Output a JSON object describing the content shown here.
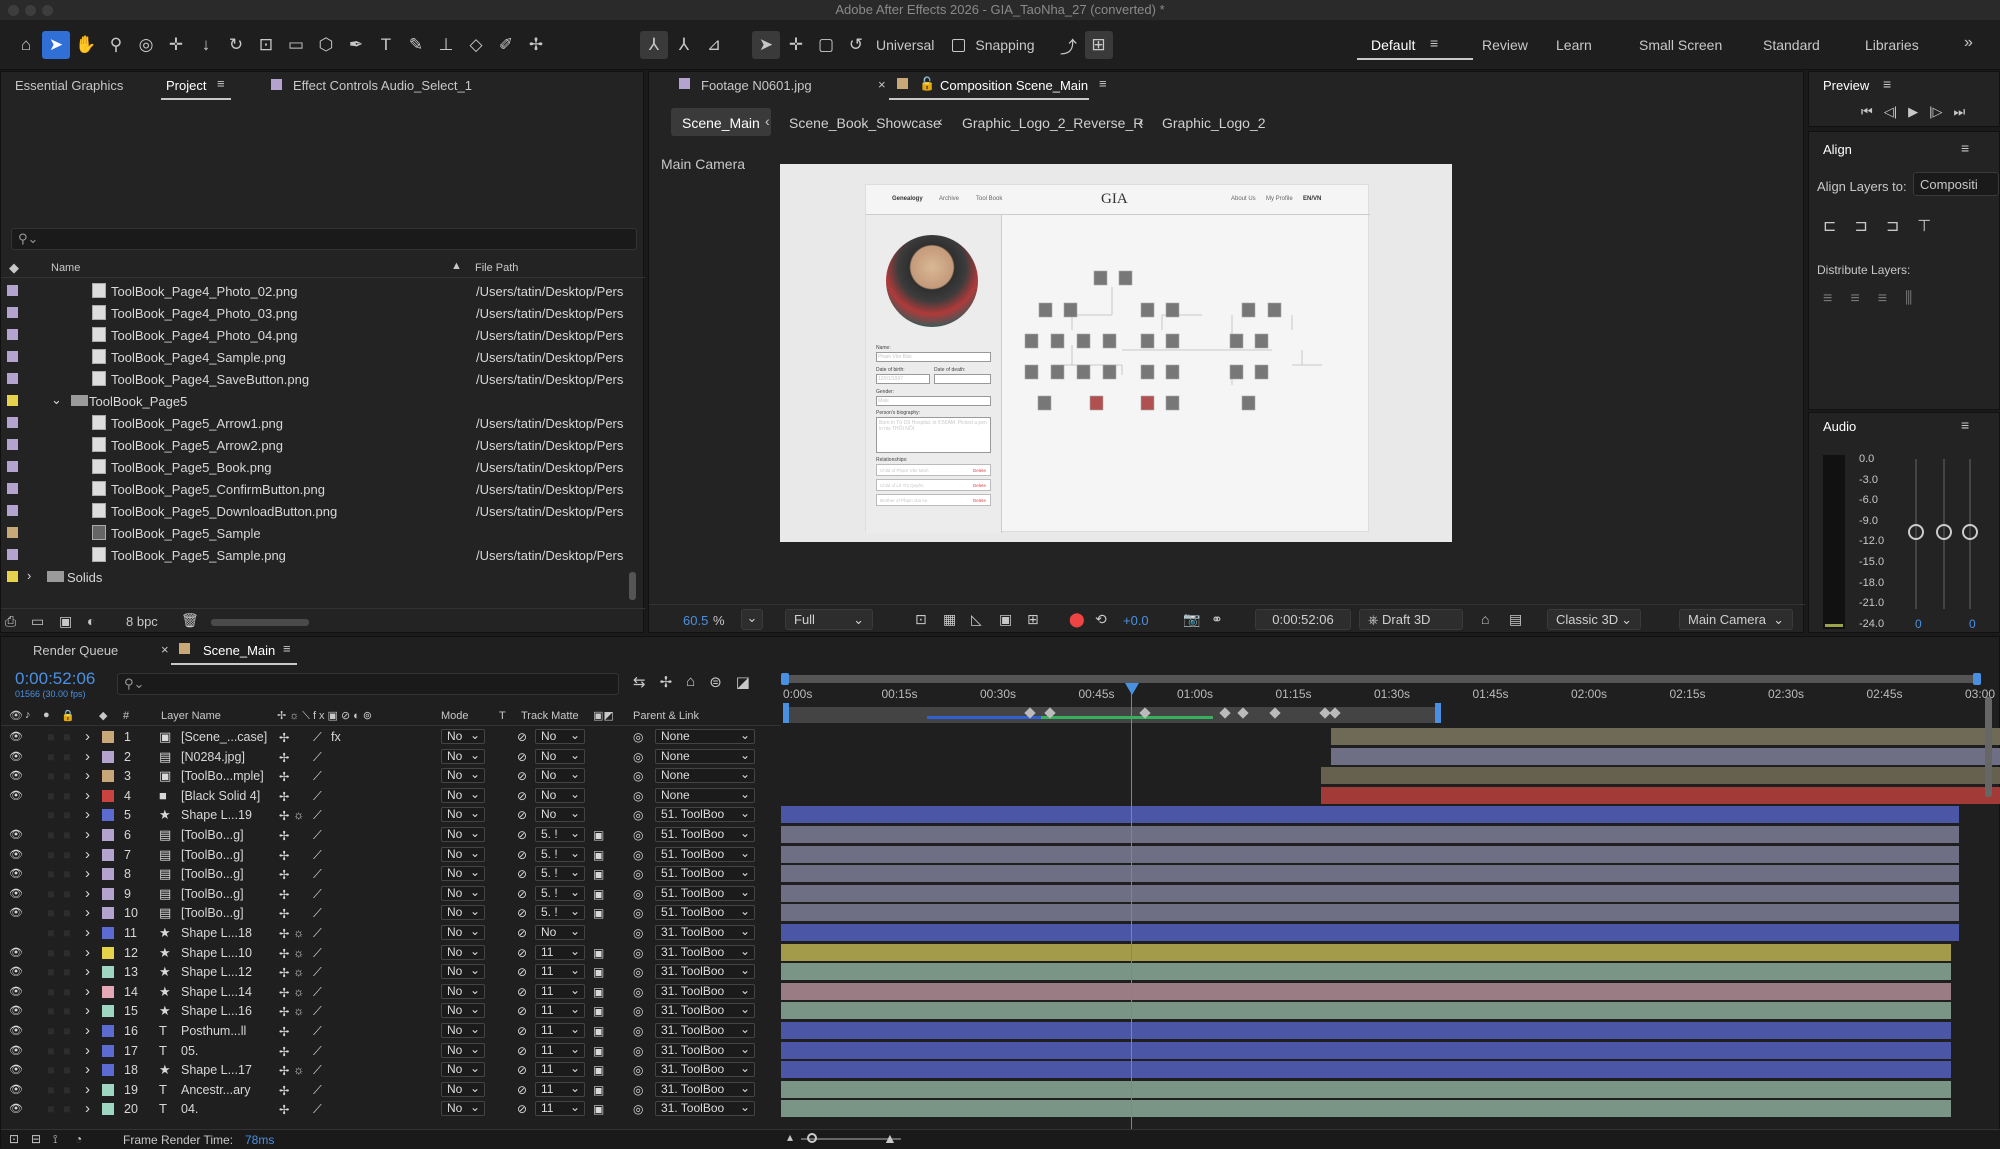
{
  "window_title": "Adobe After Effects 2026 - GIA_TaoNha_27 (converted) *",
  "toolbar": {
    "universal": "Universal",
    "snapping": "Snapping"
  },
  "workspaces": [
    "Default",
    "Review",
    "Learn",
    "Small Screen",
    "Standard",
    "Libraries"
  ],
  "left_tabs": {
    "essential": "Essential Graphics",
    "project": "Project",
    "effect": "Effect Controls Audio_Select_1"
  },
  "project": {
    "col_name": "Name",
    "col_path": "File Path",
    "bpc": "8 bpc",
    "rows": [
      {
        "name": "ToolBook_Page4_Photo_02.png",
        "path": "/Users/tatin/Desktop/Pers",
        "color": "#b4a2cf",
        "type": "file"
      },
      {
        "name": "ToolBook_Page4_Photo_03.png",
        "path": "/Users/tatin/Desktop/Pers",
        "color": "#b4a2cf",
        "type": "file"
      },
      {
        "name": "ToolBook_Page4_Photo_04.png",
        "path": "/Users/tatin/Desktop/Pers",
        "color": "#b4a2cf",
        "type": "file"
      },
      {
        "name": "ToolBook_Page4_Sample.png",
        "path": "/Users/tatin/Desktop/Pers",
        "color": "#b4a2cf",
        "type": "file"
      },
      {
        "name": "ToolBook_Page4_SaveButton.png",
        "path": "/Users/tatin/Desktop/Pers",
        "color": "#b4a2cf",
        "type": "file"
      },
      {
        "name": "ToolBook_Page5",
        "path": "",
        "color": "#e6d24b",
        "type": "folder"
      },
      {
        "name": "ToolBook_Page5_Arrow1.png",
        "path": "/Users/tatin/Desktop/Pers",
        "color": "#b4a2cf",
        "type": "file"
      },
      {
        "name": "ToolBook_Page5_Arrow2.png",
        "path": "/Users/tatin/Desktop/Pers",
        "color": "#b4a2cf",
        "type": "file"
      },
      {
        "name": "ToolBook_Page5_Book.png",
        "path": "/Users/tatin/Desktop/Pers",
        "color": "#b4a2cf",
        "type": "file"
      },
      {
        "name": "ToolBook_Page5_ConfirmButton.png",
        "path": "/Users/tatin/Desktop/Pers",
        "color": "#b4a2cf",
        "type": "file"
      },
      {
        "name": "ToolBook_Page5_DownloadButton.png",
        "path": "/Users/tatin/Desktop/Pers",
        "color": "#b4a2cf",
        "type": "file"
      },
      {
        "name": "ToolBook_Page5_Sample",
        "path": "",
        "color": "#c8a878",
        "type": "comp"
      },
      {
        "name": "ToolBook_Page5_Sample.png",
        "path": "/Users/tatin/Desktop/Pers",
        "color": "#b4a2cf",
        "type": "file"
      },
      {
        "name": "Solids",
        "path": "",
        "color": "#e6d24b",
        "type": "folder"
      }
    ]
  },
  "viewer": {
    "tab_footage": "Footage N0601.jpg",
    "tab_comp": "Composition Scene_Main",
    "crumbs": [
      "Scene_Main",
      "Scene_Book_Showcase",
      "Graphic_Logo_2_Reverse_R",
      "Graphic_Logo_2"
    ],
    "camera_label": "Main Camera",
    "zoom": "60.5",
    "zoom_unit": "%",
    "resolution": "Full",
    "exposure": "+0.0",
    "timecode": "0:00:52:06",
    "draft": "Draft 3D",
    "renderer": "Classic 3D",
    "camera": "Main Camera",
    "mock": {
      "nav": [
        "Genealogy",
        "Archive",
        "Tool Book"
      ],
      "logo": "GIA",
      "nav_right": [
        "About Us",
        "My Profile",
        "EN/VN"
      ],
      "name_label": "Name:",
      "name_value": "Phạm Văn Bảo",
      "dob_label": "Date of birth:",
      "dob_value": "12/01/1997",
      "dod_label": "Date of death:",
      "gender_label": "Gender:",
      "gender_value": "Male",
      "bio_label": "Person's biography:",
      "bio_value": "Born in Từ Dũ Hospital, in 6:55AM. Picked a pen in his THÔI NÔI.",
      "rel_label": "Relationships:",
      "relations": [
        "Child of Phạm Văn Minh",
        "Child of Lê Thị Quyên",
        "Brother of Phạm Gia An"
      ],
      "delete": "Delete"
    }
  },
  "preview": {
    "title": "Preview"
  },
  "align": {
    "title": "Align",
    "align_to_label": "Align Layers to:",
    "align_to_value": "Compositi",
    "distribute": "Distribute Layers:"
  },
  "audio": {
    "title": "Audio",
    "levels": [
      "0.0",
      "-3.0",
      "-6.0",
      "-9.0",
      "-12.0",
      "-15.0",
      "-18.0",
      "-21.0",
      "-24.0"
    ],
    "left_val": "0",
    "right_val": "0"
  },
  "timeline": {
    "tab_render": "Render Queue",
    "tab_comp": "Scene_Main",
    "timecode": "0:00:52:06",
    "frames": "01566 (30.00 fps)",
    "col_layer": "Layer Name",
    "col_mode": "Mode",
    "col_t": "T",
    "col_matte": "Track Matte",
    "col_parent": "Parent & Link",
    "ticks": [
      "0:00s",
      "00:15s",
      "00:30s",
      "00:45s",
      "01:00s",
      "01:15s",
      "01:30s",
      "01:45s",
      "02:00s",
      "02:15s",
      "02:30s",
      "02:45s",
      "03:00"
    ],
    "frame_render_label": "Frame Render Time:",
    "frame_render_value": "78ms",
    "layers": [
      {
        "n": "1",
        "name": "[Scene_...case]",
        "label": "#c8a878",
        "kind": "comp",
        "mode": "No",
        "matte": "No",
        "parent": "None",
        "bar": "#6e6a56"
      },
      {
        "n": "2",
        "name": "[N0284.jpg]",
        "label": "#b4a2cf",
        "kind": "file",
        "mode": "No",
        "matte": "No",
        "parent": "None",
        "bar": "#6e6f85"
      },
      {
        "n": "3",
        "name": "[ToolBo...mple]",
        "label": "#c8a878",
        "kind": "comp",
        "mode": "No",
        "matte": "No",
        "parent": "None",
        "bar": "#66604f"
      },
      {
        "n": "4",
        "name": "[Black Solid 4]",
        "label": "#c9443f",
        "kind": "solid",
        "mode": "No",
        "matte": "No",
        "parent": "None",
        "bar": "#a23a38"
      },
      {
        "n": "5",
        "name": "Shape L...19",
        "label": "#5c6bd1",
        "kind": "shape",
        "mode": "No",
        "matte": "No",
        "parent": "51. ToolBoo",
        "bar": "#4b57a6"
      },
      {
        "n": "6",
        "name": "[ToolBo...g]",
        "label": "#b4a2cf",
        "kind": "file",
        "mode": "No",
        "matte": "5. !",
        "parent": "51. ToolBoo",
        "bar": "#6e6f85"
      },
      {
        "n": "7",
        "name": "[ToolBo...g]",
        "label": "#b4a2cf",
        "kind": "file",
        "mode": "No",
        "matte": "5. !",
        "parent": "51. ToolBoo",
        "bar": "#6e6f85"
      },
      {
        "n": "8",
        "name": "[ToolBo...g]",
        "label": "#b4a2cf",
        "kind": "file",
        "mode": "No",
        "matte": "5. !",
        "parent": "51. ToolBoo",
        "bar": "#6e6f85"
      },
      {
        "n": "9",
        "name": "[ToolBo...g]",
        "label": "#b4a2cf",
        "kind": "file",
        "mode": "No",
        "matte": "5. !",
        "parent": "51. ToolBoo",
        "bar": "#6e6f85"
      },
      {
        "n": "10",
        "name": "[ToolBo...g]",
        "label": "#b4a2cf",
        "kind": "file",
        "mode": "No",
        "matte": "5. !",
        "parent": "51. ToolBoo",
        "bar": "#6e6f85"
      },
      {
        "n": "11",
        "name": "Shape L...18",
        "label": "#5c6bd1",
        "kind": "shape",
        "mode": "No",
        "matte": "No",
        "parent": "31. ToolBoo",
        "bar": "#4b57a6"
      },
      {
        "n": "12",
        "name": "Shape L...10",
        "label": "#e6d24b",
        "kind": "shape",
        "mode": "No",
        "matte": "11",
        "parent": "31. ToolBoo",
        "bar": "#a49b4a"
      },
      {
        "n": "13",
        "name": "Shape L...12",
        "label": "#9fd6c1",
        "kind": "shape",
        "mode": "No",
        "matte": "11",
        "parent": "31. ToolBoo",
        "bar": "#7a9486"
      },
      {
        "n": "14",
        "name": "Shape L...14",
        "label": "#e5a8b7",
        "kind": "shape",
        "mode": "No",
        "matte": "11",
        "parent": "31. ToolBoo",
        "bar": "#9a7c84"
      },
      {
        "n": "15",
        "name": "Shape L...16",
        "label": "#9fd6c1",
        "kind": "shape",
        "mode": "No",
        "matte": "11",
        "parent": "31. ToolBoo",
        "bar": "#7a9486"
      },
      {
        "n": "16",
        "name": "Posthum...ll",
        "label": "#5c6bd1",
        "kind": "text",
        "mode": "No",
        "matte": "11",
        "parent": "31. ToolBoo",
        "bar": "#4b57a6"
      },
      {
        "n": "17",
        "name": "05.",
        "label": "#5c6bd1",
        "kind": "text",
        "mode": "No",
        "matte": "11",
        "parent": "31. ToolBoo",
        "bar": "#4b57a6"
      },
      {
        "n": "18",
        "name": "Shape L...17",
        "label": "#5c6bd1",
        "kind": "shape",
        "mode": "No",
        "matte": "11",
        "parent": "31. ToolBoo",
        "bar": "#4b57a6"
      },
      {
        "n": "19",
        "name": "Ancestr...ary",
        "label": "#9fd6c1",
        "kind": "text",
        "mode": "No",
        "matte": "11",
        "parent": "31. ToolBoo",
        "bar": "#7a9486"
      },
      {
        "n": "20",
        "name": "04.",
        "label": "#9fd6c1",
        "kind": "text",
        "mode": "No",
        "matte": "11",
        "parent": "31. ToolBoo",
        "bar": "#7a9486"
      }
    ]
  }
}
